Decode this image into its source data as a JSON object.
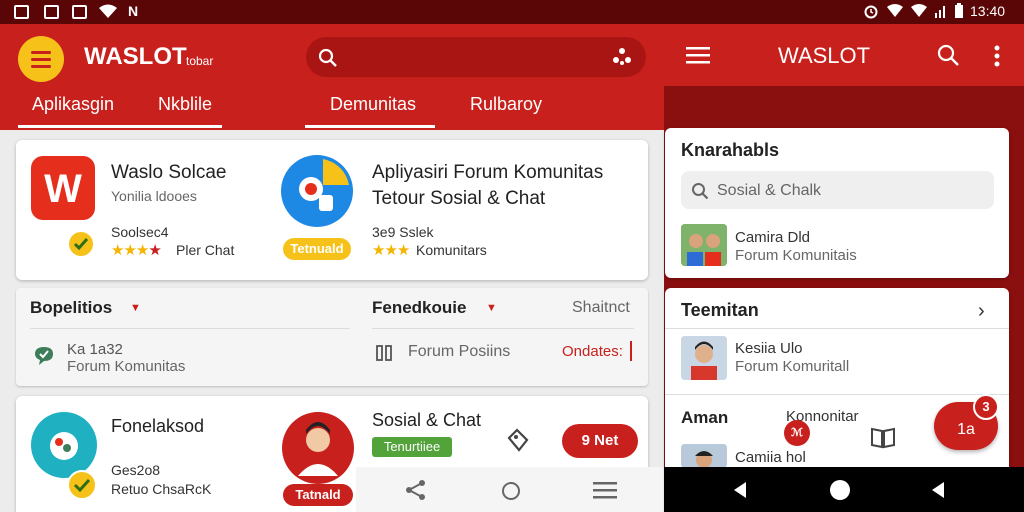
{
  "status": {
    "time": "13:40",
    "carrier": "N"
  },
  "header": {
    "brand": "WASLOT",
    "brand_sub": "tobar",
    "tabs": [
      "Aplikasgin",
      "Nkblile",
      "Demunitas",
      "Rulbaroy"
    ],
    "right_brand": "WASLOT"
  },
  "apps": [
    {
      "title": "Waslo Solcae",
      "subtitle": "Yonilia ldooes",
      "meta": "Soolsec4",
      "rating_text": "Pler Chat"
    },
    {
      "title_line1": "Apliyasiri Forum Komunitas",
      "title_line2": "Tetour Sosial & Chat",
      "meta": "3e9 Sslek",
      "rating_text": "Komunitars",
      "badge": "Tetnuald"
    }
  ],
  "filters": {
    "left_label": "Bopelitios",
    "left_meta": "Ka 1a32",
    "left_sub": "Forum Komunitas",
    "mid_label": "Fenedkouie",
    "mid_item": "Forum Posiins",
    "right_label": "Shaitnct",
    "right_status": "Ondates:"
  },
  "bottom_items": [
    {
      "title": "Fonelaksod",
      "meta": "Ges2o8",
      "sub": "Retuo ChsaRcK"
    },
    {
      "title": "Sosial & Chat",
      "tag": "Tenurtiiee",
      "badge": "Tatnald",
      "count_pill": "9 Net"
    }
  ],
  "right": {
    "panel1_title": "Knarahabls",
    "search_placeholder": "Sosial & Chalk",
    "contact1_name": "Camira Dld",
    "contact1_sub": "Forum Komunitais",
    "panel2_title": "Teemitan",
    "contact2_name": "Kesiia Ulo",
    "contact2_sub": "Forum Komuritall",
    "row_label": "Aman",
    "row_label2": "Konnonitar",
    "contact3_name": "Camiia hol",
    "fab_count": "1a",
    "fab_label": "3"
  }
}
